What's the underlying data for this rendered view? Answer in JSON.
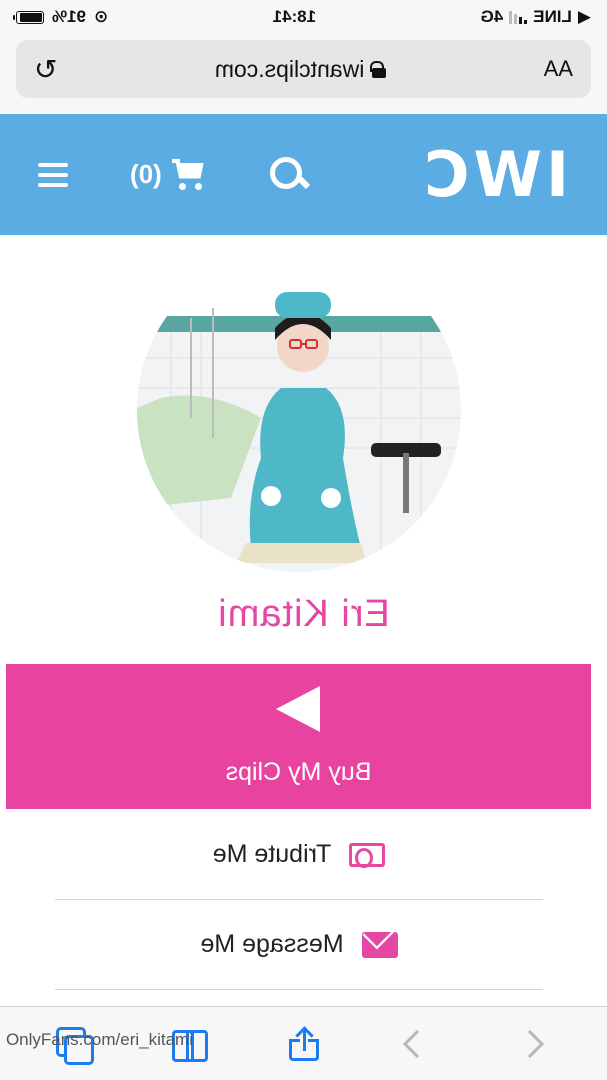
{
  "status_bar": {
    "time": "18:41",
    "carrier": "LINE",
    "network": "4G",
    "battery": "91%"
  },
  "browser": {
    "url": "iwantclips.com",
    "text_size_label": "AA",
    "reload_icon": "reload-icon"
  },
  "site_header": {
    "logo": "IWC",
    "cart_count": "(0)",
    "background_color": "#5aace2"
  },
  "profile": {
    "name": "Eri Kitami",
    "accent_color": "#e548a4"
  },
  "actions": {
    "buy_label": "Buy My Clips",
    "tribute_label": "Tribute Me",
    "message_label": "Message Me"
  },
  "toolbar": {
    "back_icon": "chevron-left-icon",
    "forward_icon": "chevron-right-icon",
    "share_icon": "share-icon",
    "bookmarks_icon": "book-icon",
    "tabs_icon": "tabs-icon"
  },
  "watermark": "OnlyFans.com/eri_kitami"
}
